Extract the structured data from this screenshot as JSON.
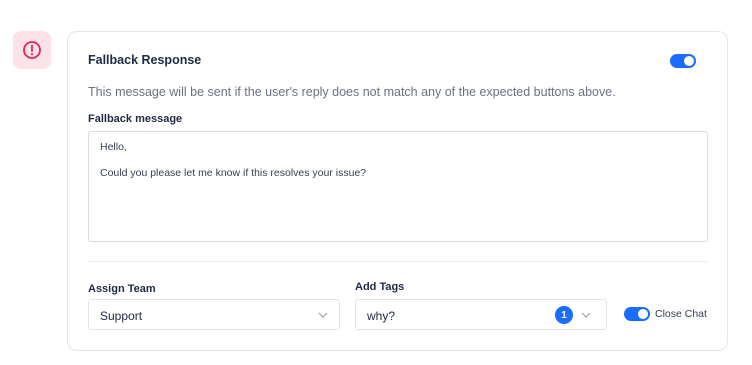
{
  "fallback": {
    "title": "Fallback Response",
    "enabled": true,
    "description": "This message will be sent if the user's reply does not match any of the expected buttons above.",
    "message_label": "Fallback message",
    "message_lines": [
      "Hello,",
      "Could you please let me know if this resolves your issue?"
    ]
  },
  "assign_team": {
    "label": "Assign Team",
    "selected": "Support"
  },
  "add_tags": {
    "label": "Add Tags",
    "selected": "why?",
    "count": "1"
  },
  "close_chat": {
    "label": "Close Chat",
    "enabled": true
  },
  "colors": {
    "accent": "#1a6dfa",
    "alert_bg": "#fde3e8",
    "alert_icon": "#e0245e"
  },
  "icons": {
    "alert": "exclamation-circle-icon",
    "chevron": "chevron-down-icon"
  }
}
